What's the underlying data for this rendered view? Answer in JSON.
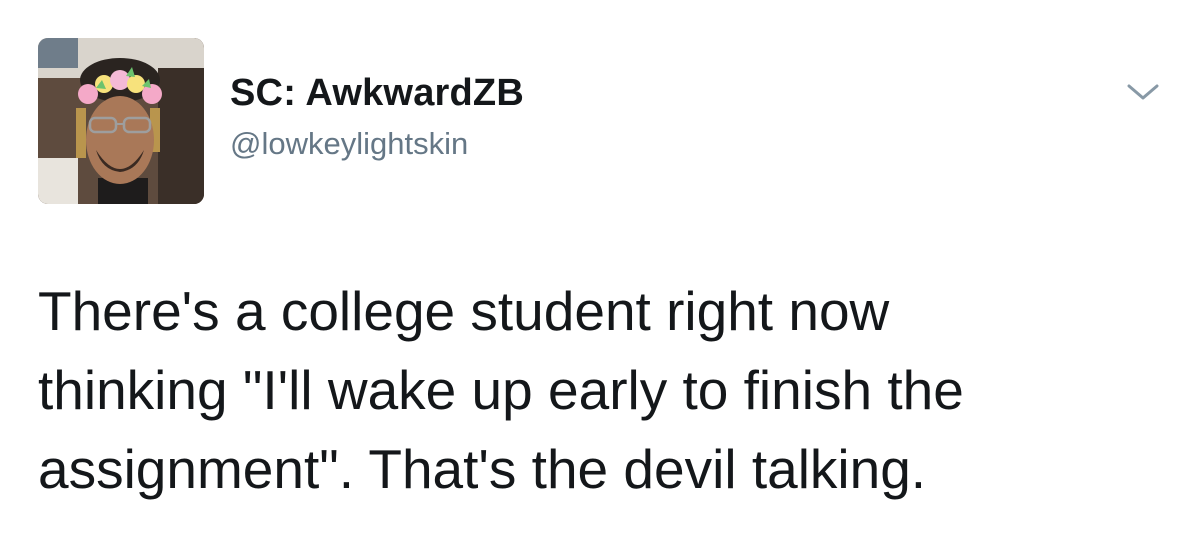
{
  "tweet": {
    "display_name": "SC: AwkwardZB",
    "handle": "@lowkeylightskin",
    "text_lines": [
      "There's a college student right now",
      "thinking \"I'll wake up early to finish the",
      "assignment\". That's the devil talking."
    ]
  },
  "icons": {
    "menu": "chevron-down-icon",
    "avatar": "profile-photo"
  },
  "colors": {
    "text": "#14171a",
    "secondary": "#657786",
    "background": "#ffffff"
  }
}
